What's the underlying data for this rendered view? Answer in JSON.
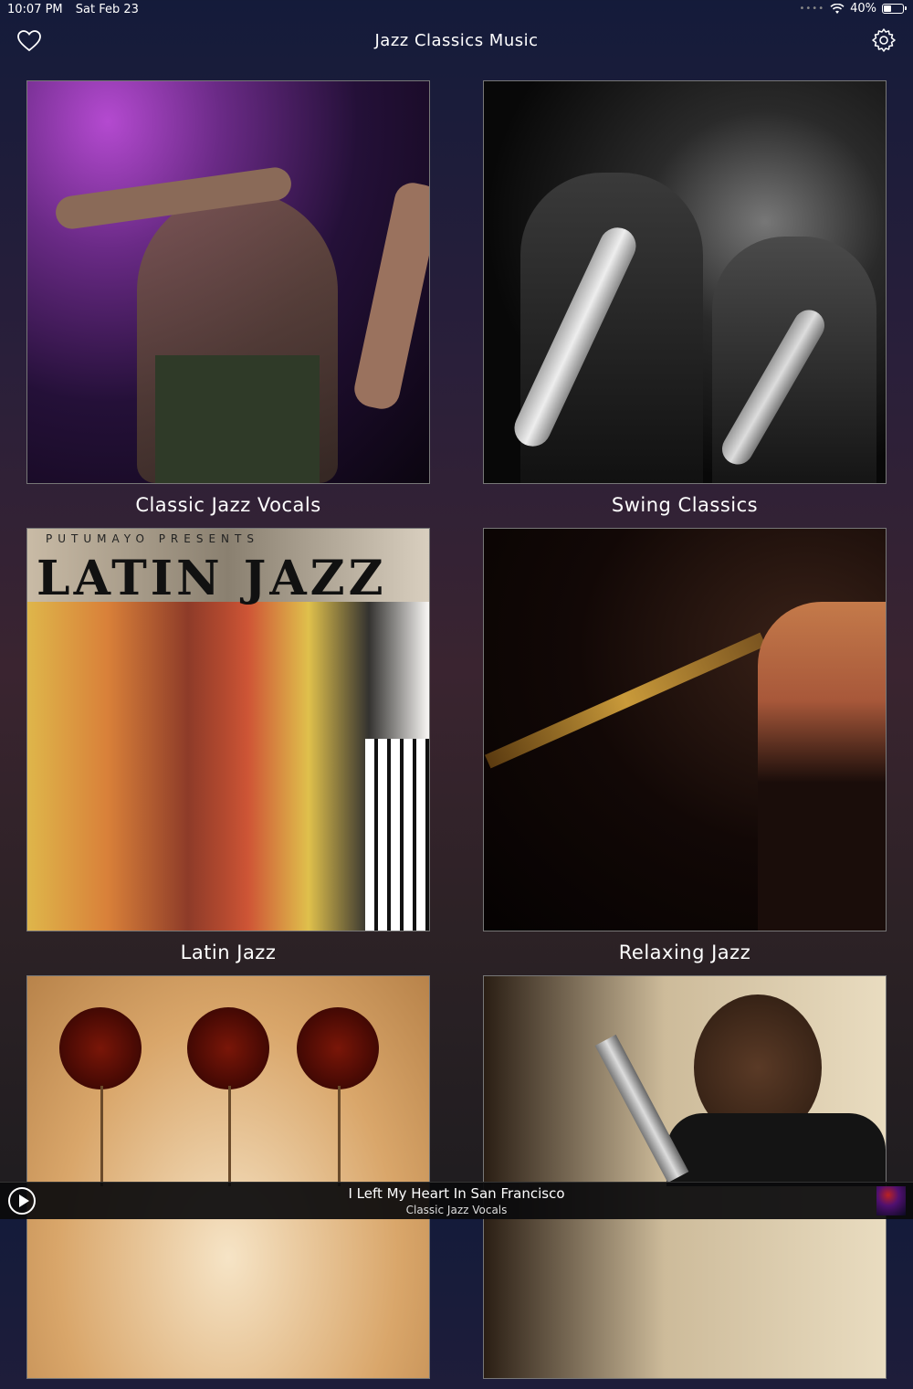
{
  "status": {
    "time": "10:07 PM",
    "date": "Sat Feb 23",
    "battery": "40%",
    "battery_level": 0.4
  },
  "nav": {
    "title": "Jazz Classics Music",
    "left_icon": "heart-icon",
    "right_icon": "gear-icon"
  },
  "categories": [
    {
      "label": "Classic Jazz Vocals"
    },
    {
      "label": "Swing Classics"
    },
    {
      "label": "Latin Jazz",
      "art_text_top": "PUTUMAYO PRESENTS",
      "art_text_main": "LATIN JAZZ"
    },
    {
      "label": "Relaxing Jazz"
    },
    {
      "label": ""
    },
    {
      "label": ""
    }
  ],
  "player": {
    "title": "I Left My Heart In San Francisco",
    "subtitle": "Classic Jazz Vocals",
    "play_icon": "play-icon"
  }
}
